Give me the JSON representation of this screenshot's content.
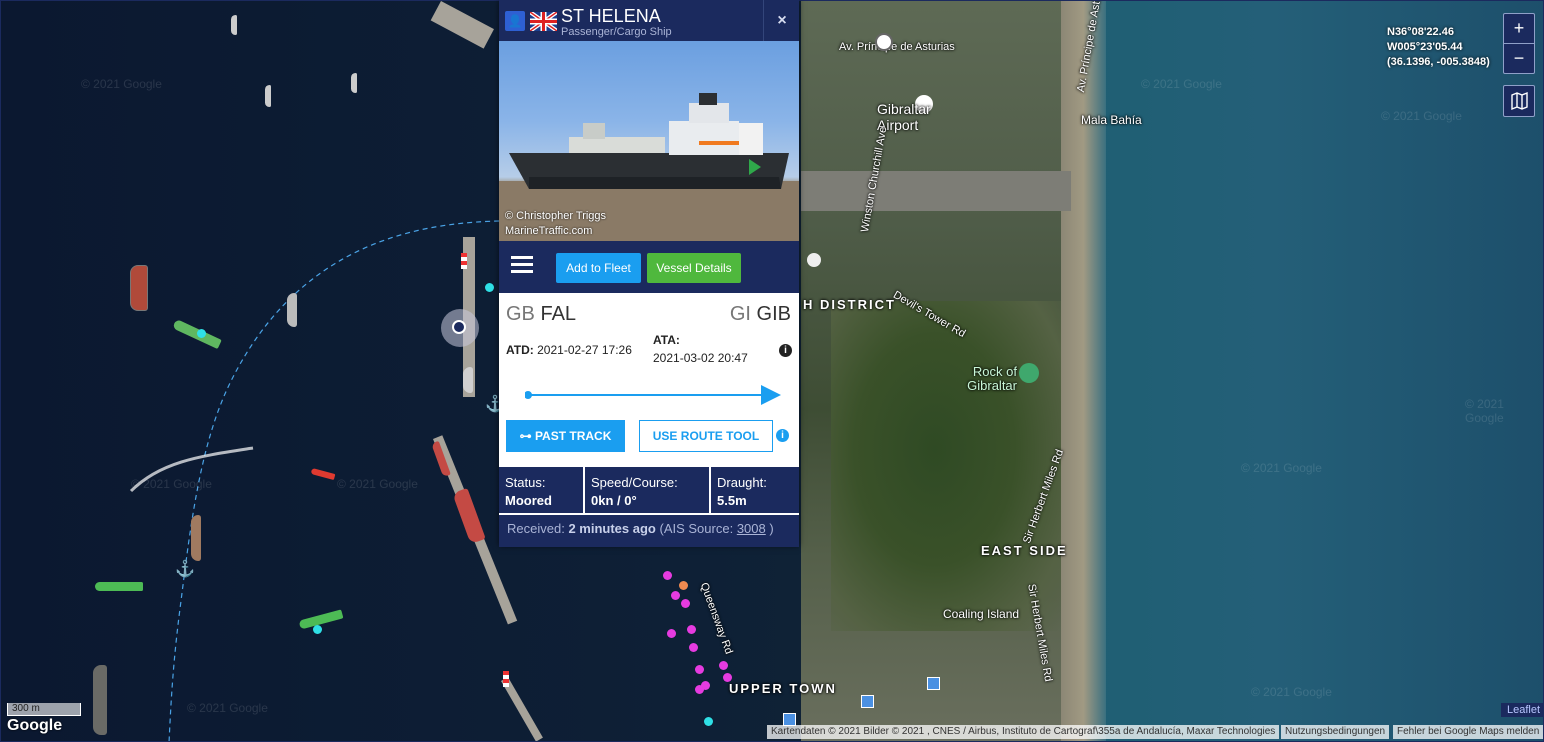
{
  "popup": {
    "vessel_name": "ST HELENA",
    "vessel_type": "Passenger/Cargo Ship",
    "flag_icon": "uk-flag-icon",
    "close_label": "×",
    "photo_credit_line1": "© Christopher Triggs",
    "photo_credit_line2": "MarineTraffic.com",
    "add_to_fleet_label": "Add to Fleet",
    "vessel_details_label": "Vessel Details",
    "origin": {
      "country_code": "GB",
      "port_code": "FAL"
    },
    "destination": {
      "country_code": "GI",
      "port_code": "GIB"
    },
    "atd_label": "ATD:",
    "atd_value": "2021-02-27 17:26",
    "ata_label": "ATA:",
    "ata_value": "2021-03-02 20:47",
    "past_track_label": "PAST TRACK",
    "use_route_tool_label": "USE ROUTE TOOL",
    "status_label": "Status:",
    "status_value": "Moored",
    "speed_label": "Speed/Course:",
    "speed_value": "0kn / 0°",
    "draught_label": "Draught:",
    "draught_value": "5.5m",
    "received_prefix": "Received:",
    "received_value": "2 minutes ago",
    "ais_prefix": "(AIS Source:",
    "ais_source": "3008",
    "ais_suffix": ")",
    "accent_color": "#1a9ef0",
    "header_color": "#1b2a5e"
  },
  "map": {
    "coord_lat": "N36°08'22.46",
    "coord_lon": "W005°23'05.44",
    "coord_decimal": "(36.1396, -005.3848)",
    "zoom_in_label": "+",
    "zoom_out_label": "−",
    "scale_label": "300 m",
    "google_logo": "Google",
    "attribution": "Kartendaten © 2021 Bilder © 2021 , CNES / Airbus, Instituto de Cartograf\\355a de Andalucía, Maxar Technologies",
    "terms": "Nutzungsbedingungen",
    "report_error": "Fehler bei Google Maps melden",
    "leaflet": "Leaflet",
    "watermark": "© 2021 Google",
    "labels": {
      "asturias": "Av. Príncipe de Asturias",
      "airport": "Gibraltar Airport",
      "mala_bahia": "Mala Bahía",
      "churchill": "Winston Churchill Ave",
      "devils_tower": "Devil's Tower Rd",
      "district": "H DISTRICT",
      "rock": "Rock of Gibraltar",
      "east_side": "EAST SIDE",
      "herbert_miles": "Sir Herbert Miles Rd",
      "coaling_island": "Coaling Island",
      "queensway": "Queensway Rd",
      "upper_town": "UPPER TOWN",
      "principe_asturias_v": "Av. Príncipe de Asturias"
    }
  }
}
